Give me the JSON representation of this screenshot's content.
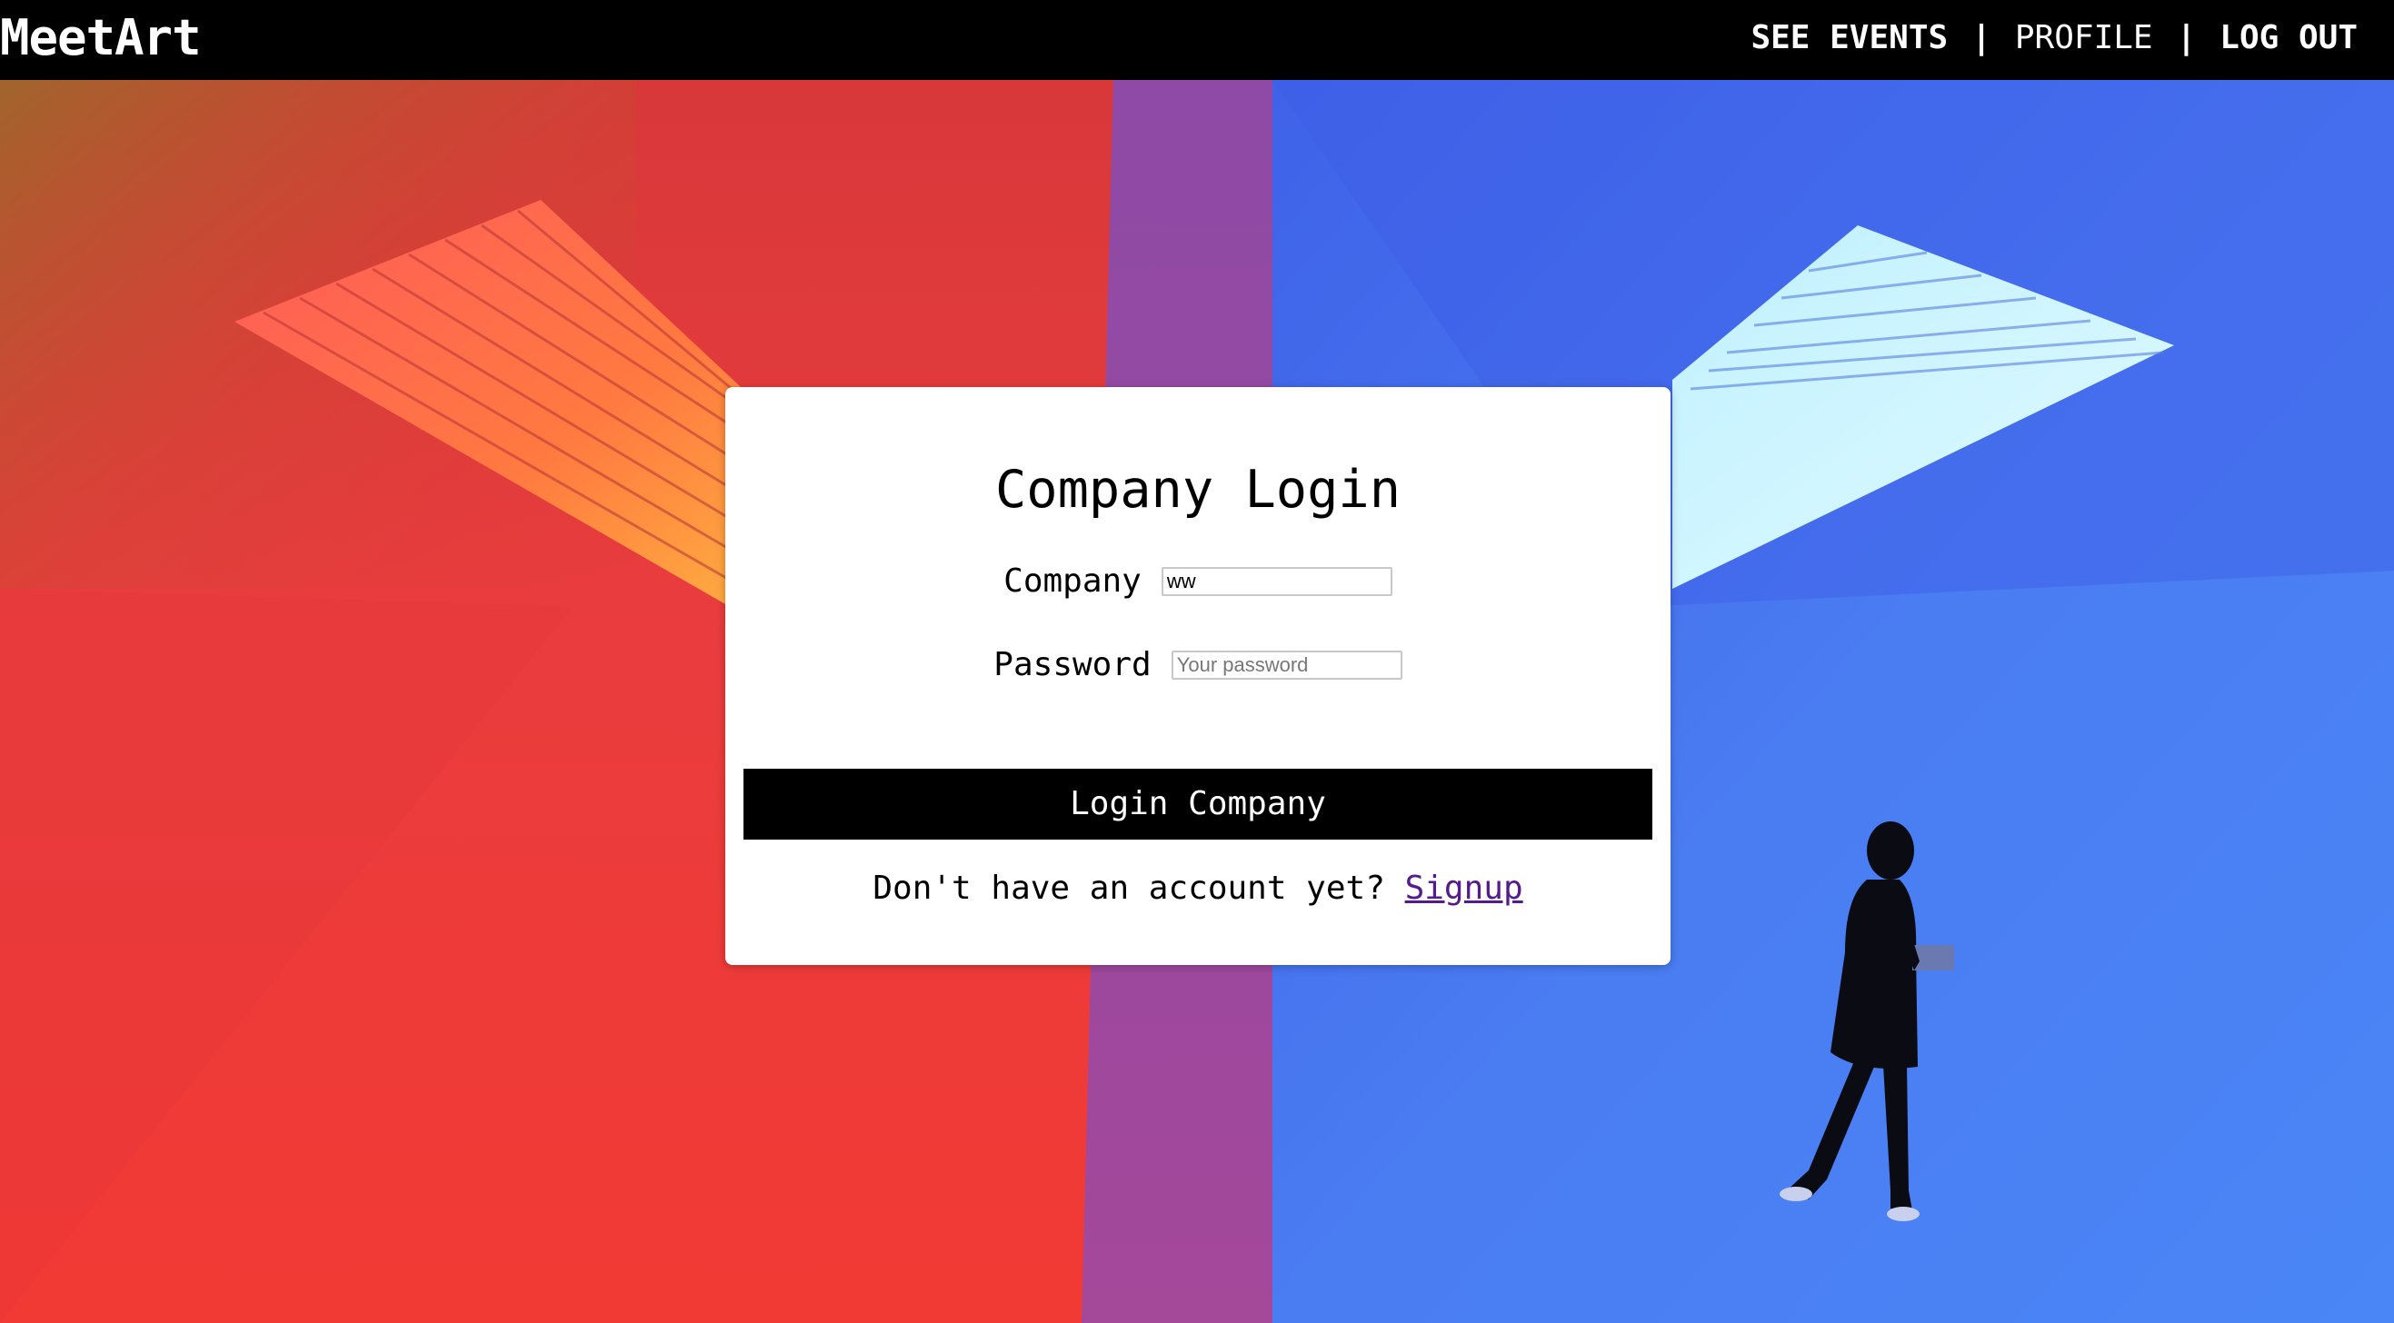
{
  "navbar": {
    "brand": "MeetArt",
    "links": [
      {
        "label": "SEE EVENTS"
      },
      {
        "label": "PROFILE"
      },
      {
        "label": "LOG OUT"
      }
    ],
    "separator": "|"
  },
  "login": {
    "title": "Company Login",
    "company_label": "Company",
    "company_value": "ww",
    "password_label": "Password",
    "password_placeholder": "Your password",
    "submit_label": "Login Company",
    "signup_prompt": "Don't have an account yet?",
    "signup_link": "Signup"
  },
  "colors": {
    "navbar_bg": "#000000",
    "button_bg": "#000000",
    "link_visited": "#551a8b",
    "art_red": "#ee3a36",
    "art_purple": "#9a4a9e",
    "art_blue": "#4a78ee"
  }
}
